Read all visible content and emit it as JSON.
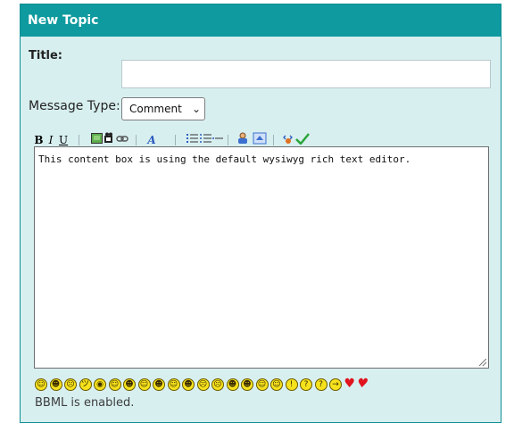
{
  "header": {
    "title": "New Topic"
  },
  "form": {
    "title_label": "Title:",
    "title_value": "",
    "message_type_label": "Message Type:",
    "message_type_selected": "Comment"
  },
  "toolbar": {
    "bold": "B",
    "italic": "I",
    "underline": "U",
    "font": "A"
  },
  "editor": {
    "content": "This content box is using the default wysiwyg rich text editor."
  },
  "smileys": {
    "faces": [
      "☺",
      "☻",
      "☹",
      "ツ",
      "◉",
      "☺",
      "☻",
      "☺",
      "☻",
      "☺",
      "☻",
      "☹",
      "☹",
      "☻",
      "☻",
      "☺",
      "☺",
      "!",
      "?",
      "?",
      "→"
    ]
  },
  "footer": {
    "bbml_status": "BBML is enabled."
  },
  "colors": {
    "header": "#0e9a9e",
    "panel": "#d8eff0",
    "smiley": "#f6e21c",
    "heart": "#e0141e"
  }
}
